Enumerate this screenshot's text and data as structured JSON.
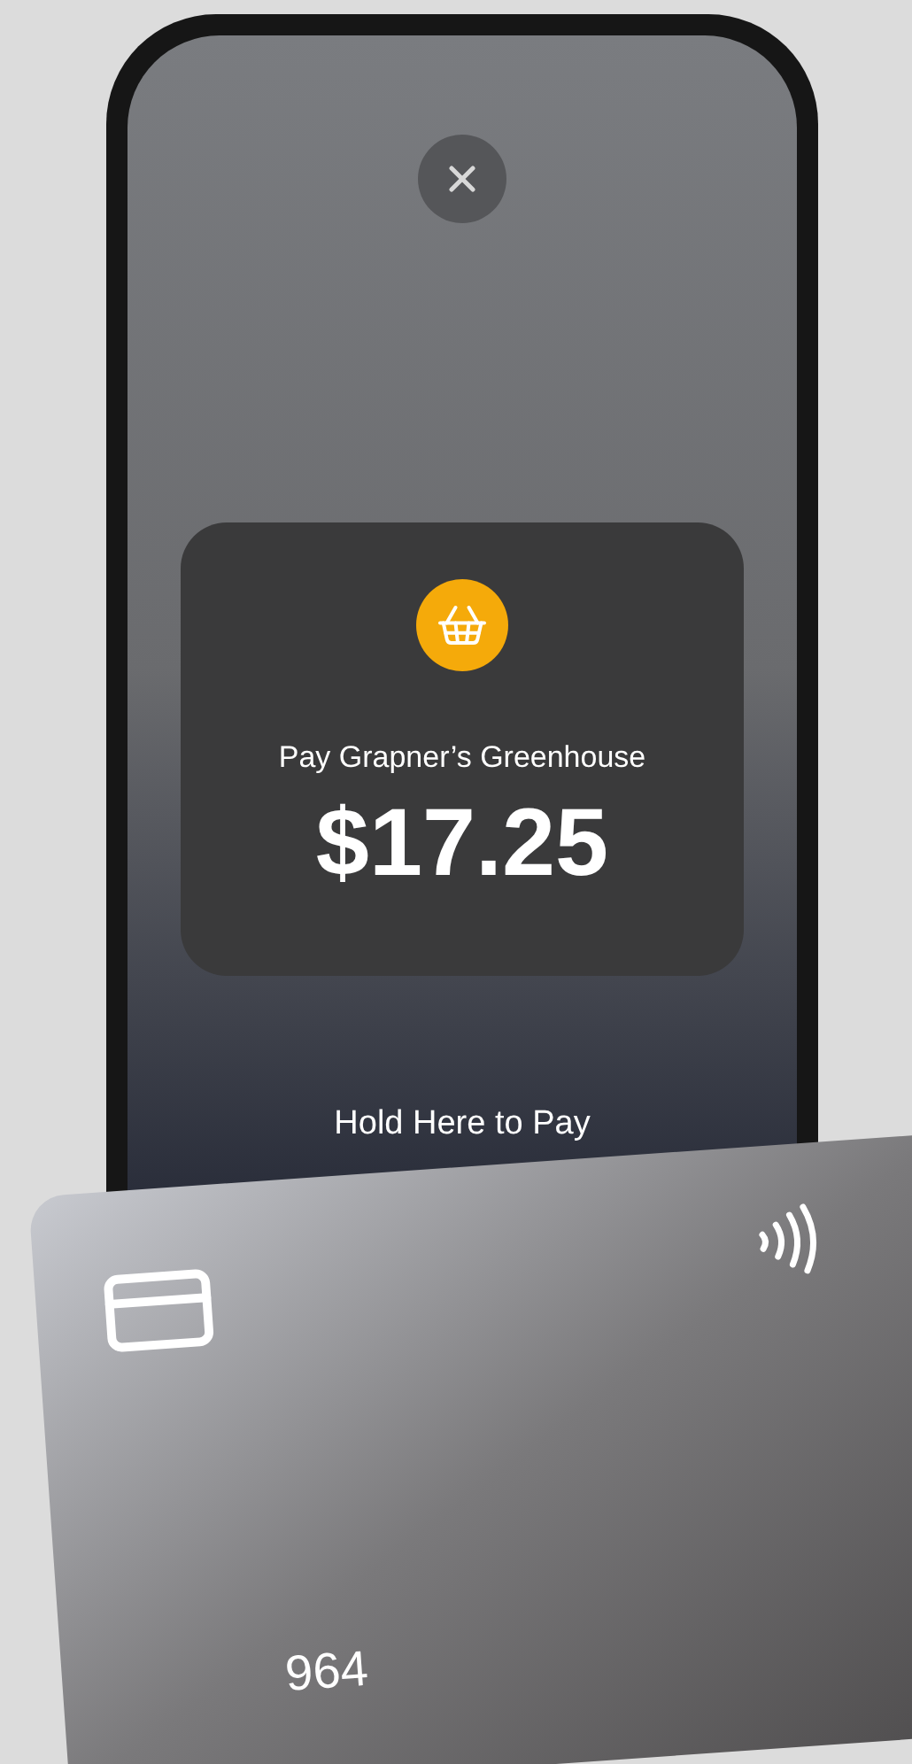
{
  "payment_sheet": {
    "merchant_line": "Pay Grapner’s Greenhouse",
    "amount": "$17.25"
  },
  "prompt": "Hold Here to Pay",
  "card": {
    "number_suffix": "964"
  }
}
